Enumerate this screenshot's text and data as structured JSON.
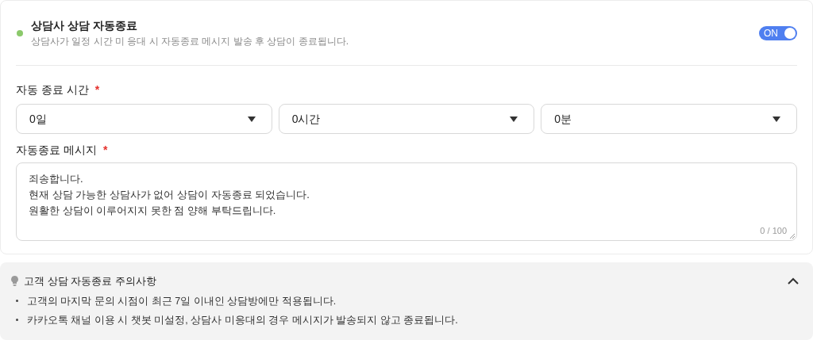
{
  "setting": {
    "title": "상담사 상담 자동종료",
    "description": "상담사가 일정 시간 미 응대 시 자동종료 메시지 발송 후 상담이 종료됩니다.",
    "toggle": {
      "label": "ON",
      "on": true
    }
  },
  "duration": {
    "label": "자동 종료 시간",
    "required_mark": "*",
    "selects": [
      {
        "value": "0일"
      },
      {
        "value": "0시간"
      },
      {
        "value": "0분"
      }
    ]
  },
  "message": {
    "label": "자동종료 메시지",
    "required_mark": "*",
    "value": "죄송합니다.\n현재 상담 가능한 상담사가 없어 상담이 자동종료 되었습니다.\n원활한 상담이 이루어지지 못한 점 양해 부탁드립니다.",
    "counter": "0 / 100"
  },
  "notice": {
    "title": "고객 상담 자동종료 주의사항",
    "expanded": true,
    "items": [
      "고객의 마지막 문의 시점이 최근 7일 이내인 상담방에만 적용됩니다.",
      "카카오톡 채널 이용 시 챗봇 미설정, 상담사 미응대의 경우 메시지가 발송되지 않고 종료됩니다."
    ]
  }
}
